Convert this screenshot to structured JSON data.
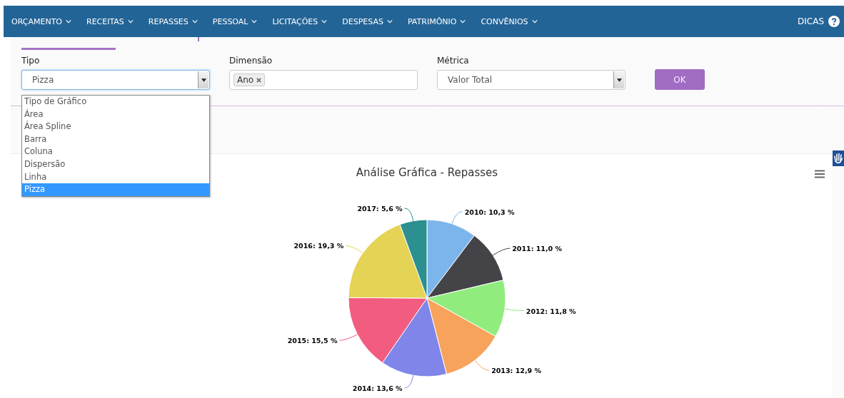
{
  "nav": {
    "items": [
      {
        "label": "ORÇAMENTO"
      },
      {
        "label": "RECEITAS"
      },
      {
        "label": "REPASSES"
      },
      {
        "label": "PESSOAL"
      },
      {
        "label": "LICITAÇÕES"
      },
      {
        "label": "DESPESAS"
      },
      {
        "label": "PATRIMÔNIO"
      },
      {
        "label": "CONVÊNIOS"
      }
    ],
    "help": "DICAS"
  },
  "filters": {
    "tipo": {
      "label": "Tipo",
      "value": "Pizza",
      "expanded": true,
      "options": [
        {
          "label": "Tipo de Gráfico",
          "selected": false
        },
        {
          "label": "Área",
          "selected": false
        },
        {
          "label": "Área Spline",
          "selected": false
        },
        {
          "label": "Barra",
          "selected": false
        },
        {
          "label": "Coluna",
          "selected": false
        },
        {
          "label": "Dispersão",
          "selected": false
        },
        {
          "label": "Linha",
          "selected": false
        },
        {
          "label": "Pizza",
          "selected": true
        }
      ]
    },
    "dimensao": {
      "label": "Dimensão",
      "tags": [
        "Ano"
      ]
    },
    "metrica": {
      "label": "Métrica",
      "value": "Valor Total"
    },
    "ok_button": "OK"
  },
  "chart": {
    "chart_data": {
      "type": "pie",
      "title": "Análise Gráfica - Repasses",
      "values": [
        10.3,
        11.0,
        11.8,
        12.9,
        13.6,
        15.5,
        19.3,
        5.6
      ],
      "colors": [
        "#7cb5ec",
        "#434348",
        "#90ed7d",
        "#f7a35c",
        "#8085e9",
        "#f15c80",
        "#e4d354",
        "#2b908f"
      ],
      "value_labels": [
        "2010: 10,3 %",
        "2011: 11,0 %",
        "2012: 11,8 %",
        "2013: 12,9 %",
        "2014: 13,6 %",
        "2015: 15,5 %",
        "2016: 19,3 %",
        "2017: 5,6 %"
      ]
    }
  }
}
